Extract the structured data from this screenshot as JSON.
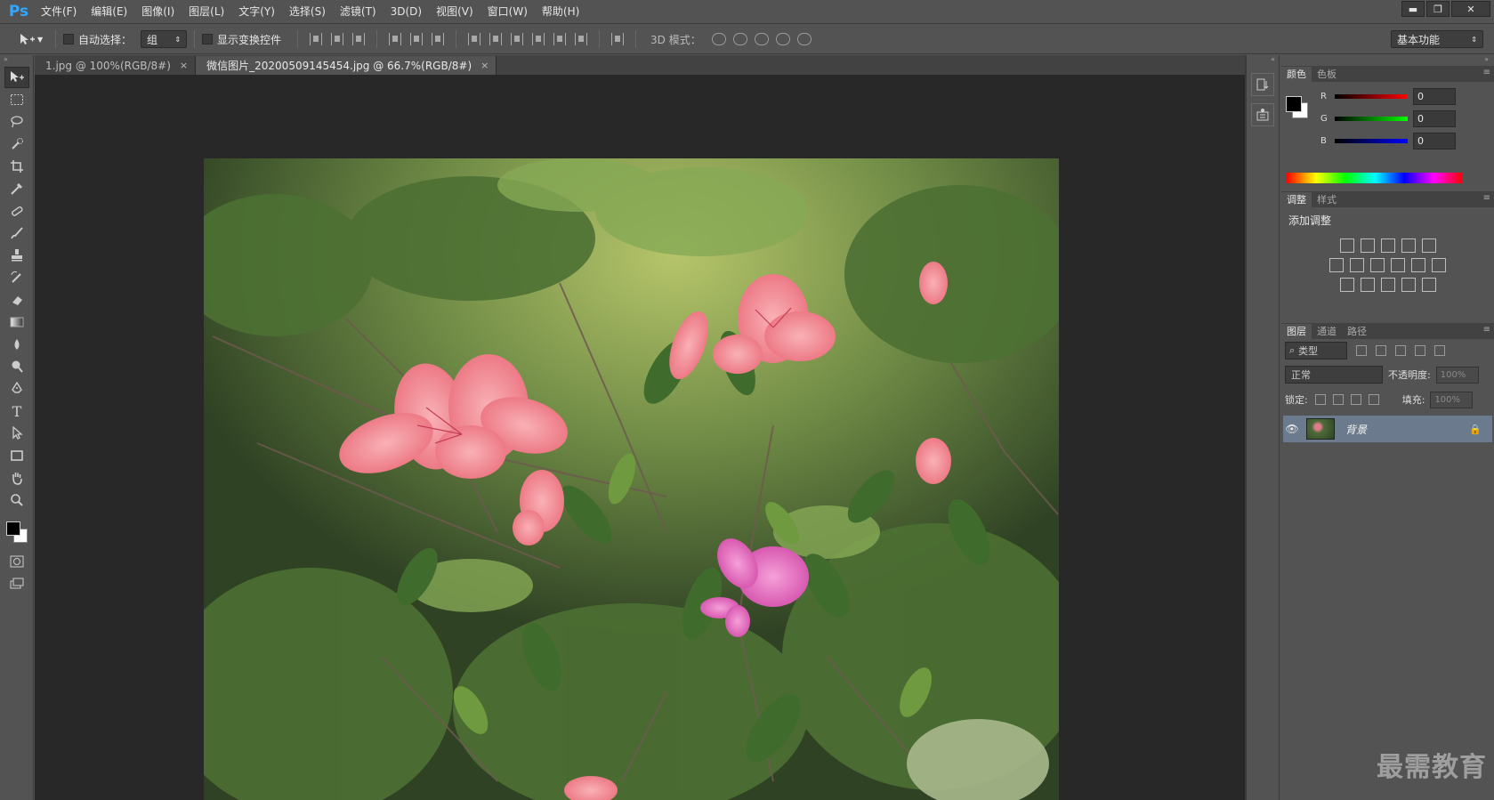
{
  "app": {
    "logo": "Ps"
  },
  "menu": [
    "文件(F)",
    "编辑(E)",
    "图像(I)",
    "图层(L)",
    "文字(Y)",
    "选择(S)",
    "滤镜(T)",
    "3D(D)",
    "视图(V)",
    "窗口(W)",
    "帮助(H)"
  ],
  "window_controls": {
    "minimize": "▬",
    "restore": "❐",
    "close": "✕"
  },
  "options": {
    "auto_select_label": "自动选择：",
    "auto_select_value": "组",
    "show_transform_label": "显示变换控件",
    "mode3d_label": "3D 模式：",
    "workspace": "基本功能"
  },
  "tabs": [
    {
      "label": "1.jpg @ 100%(RGB/8#)",
      "close": "×"
    },
    {
      "label": "微信图片_20200509145454.jpg @ 66.7%(RGB/8#)",
      "close": "×"
    }
  ],
  "color_panel": {
    "tabs": [
      "颜色",
      "色板"
    ],
    "r_label": "R",
    "r_value": "0",
    "g_label": "G",
    "g_value": "0",
    "b_label": "B",
    "b_value": "0"
  },
  "adjust_panel": {
    "tabs": [
      "调整",
      "样式"
    ],
    "title": "添加调整"
  },
  "layers_panel": {
    "tabs": [
      "图层",
      "通道",
      "路径"
    ],
    "kind": "类型",
    "blend_mode": "正常",
    "opacity_label": "不透明度:",
    "opacity_value": "100%",
    "lock_label": "锁定:",
    "fill_label": "填充:",
    "fill_value": "100%",
    "layer_name": "背景"
  },
  "watermark": "最需教育",
  "colors": {
    "accent": "#31a8ff",
    "panel_bg": "#535353",
    "canvas_bg": "#282828"
  }
}
